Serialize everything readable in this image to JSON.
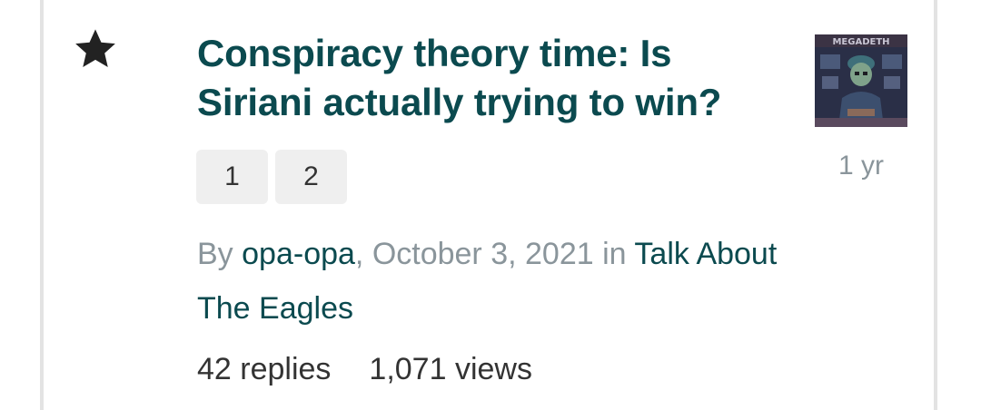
{
  "topic": {
    "title": "Conspiracy theory time: Is Siriani actually trying to win?",
    "pages": [
      "1",
      "2"
    ],
    "meta": {
      "by_prefix": "By",
      "author": "opa-opa",
      "date_text": ", October 3, 2021",
      "in_text": " in ",
      "forum": "Talk About The Eagles"
    },
    "stats": {
      "replies": "42 replies",
      "views": "1,071 views"
    },
    "last_post_age": "1 yr",
    "avatar_text": "MEGADETH",
    "starred": true,
    "icon": "star-icon"
  },
  "colors": {
    "link": "#0b4a4f",
    "muted": "#8a959b",
    "text": "#333333",
    "page_button_bg": "#efefef"
  }
}
